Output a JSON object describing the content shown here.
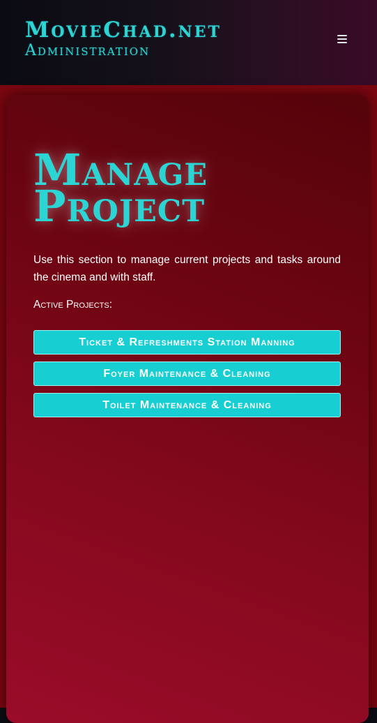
{
  "header": {
    "brand_title": "MovieChad.net",
    "brand_subtitle": "Administration",
    "menu_icon": "hamburger-menu-icon"
  },
  "main": {
    "title_line1": "Manage",
    "title_line2": "Project",
    "intro_text": "Use this section to manage current projects and tasks around the cinema and with staff.",
    "active_projects_label": "Active Projects:",
    "projects": [
      {
        "label": "Ticket & Refreshments Station Manning"
      },
      {
        "label": "Foyer Maintenance & Cleaning"
      },
      {
        "label": "Toilet Maintenance & Cleaning"
      }
    ]
  },
  "colors": {
    "accent": "#2dd4d4",
    "button": "#17cfd3",
    "card_background": "#7a0610"
  }
}
